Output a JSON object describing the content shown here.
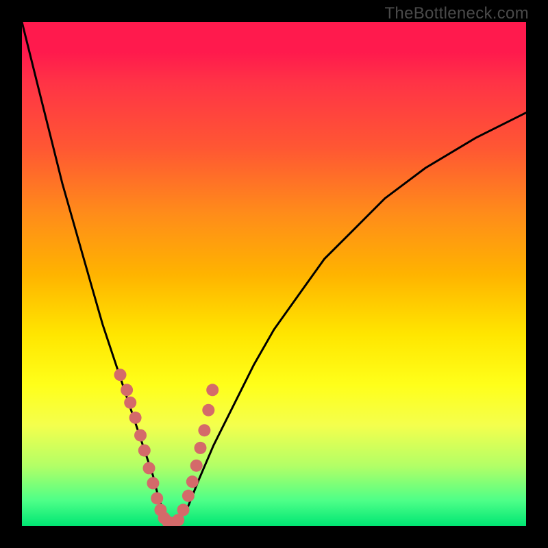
{
  "attribution": "TheBottleneck.com",
  "colors": {
    "frame": "#000000",
    "gradient_stops": [
      "#ff1a4d",
      "#ff3346",
      "#ff5733",
      "#ff8c1a",
      "#ffb300",
      "#ffe600",
      "#ffff1a",
      "#f4ff4d",
      "#b3ff66",
      "#4dff88",
      "#00e673"
    ],
    "curve": "#000000",
    "marker": "#d46a6a"
  },
  "chart_data": {
    "type": "line",
    "title": "",
    "xlabel": "",
    "ylabel": "",
    "xlim": [
      0,
      100
    ],
    "ylim": [
      0,
      100
    ],
    "series": [
      {
        "name": "bottleneck-curve",
        "x": [
          0,
          2,
          4,
          6,
          8,
          10,
          12,
          14,
          16,
          18,
          20,
          22,
          24,
          26,
          27,
          28,
          29,
          30,
          31,
          33,
          35,
          38,
          42,
          46,
          50,
          55,
          60,
          66,
          72,
          80,
          90,
          100
        ],
        "y": [
          100,
          92,
          84,
          76,
          68,
          61,
          54,
          47,
          40,
          34,
          28,
          22,
          16,
          10,
          6,
          3,
          1,
          0.5,
          1,
          4,
          9,
          16,
          24,
          32,
          39,
          46,
          53,
          59,
          65,
          71,
          77,
          82
        ]
      }
    ],
    "markers": {
      "name": "highlight-points",
      "x": [
        19.5,
        20.8,
        21.5,
        22.5,
        23.5,
        24.3,
        25.2,
        26.0,
        26.8,
        27.5,
        28.2,
        29.0,
        30.0,
        31.0,
        32.0,
        33.0,
        33.8,
        34.6,
        35.4,
        36.2,
        37.0,
        37.8
      ],
      "y": [
        30,
        27,
        24.5,
        21.5,
        18,
        15,
        11.5,
        8.5,
        5.5,
        3.2,
        1.6,
        0.8,
        0.6,
        1.2,
        3.2,
        6.0,
        8.8,
        12.0,
        15.5,
        19.0,
        23.0,
        27.0
      ]
    }
  }
}
